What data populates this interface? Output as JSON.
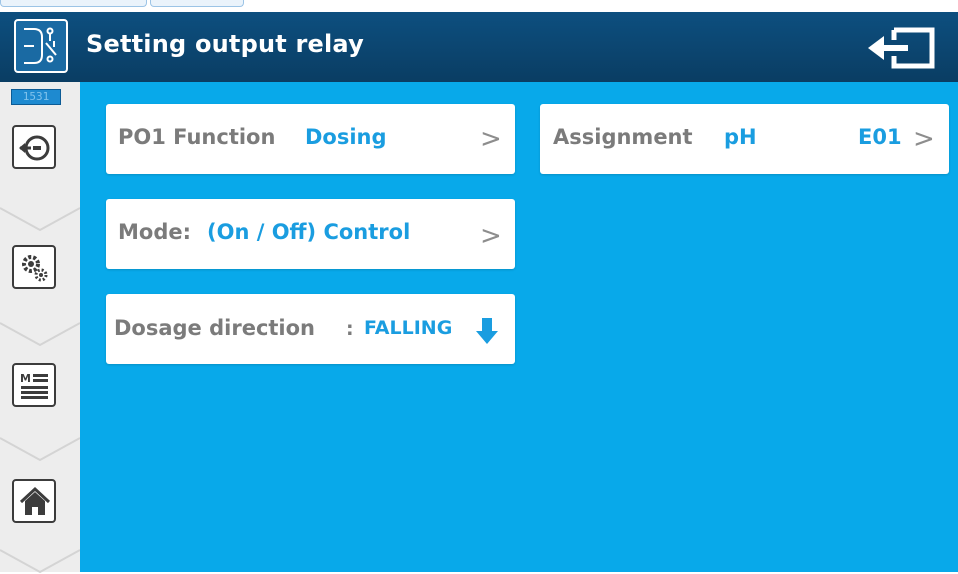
{
  "header": {
    "title": "Setting output relay",
    "icon": "relay-switch-icon",
    "exit_icon": "exit-arrow-icon"
  },
  "sidebar": {
    "counter": "1531",
    "buttons": [
      {
        "icon": "back-arrow-icon"
      },
      {
        "icon": "gears-icon"
      },
      {
        "icon": "menu-list-icon"
      },
      {
        "icon": "home-icon"
      }
    ]
  },
  "cards": {
    "function": {
      "label": "PO1 Function",
      "value": "Dosing",
      "arrow": ">"
    },
    "mode": {
      "label": "Mode:",
      "value": "(On / Off) Control",
      "arrow": ">"
    },
    "dosage": {
      "label": "Dosage direction",
      "separator": ":",
      "value": "FALLING",
      "icon": "down-arrow-icon"
    },
    "assignment": {
      "label": "Assignment",
      "value": "pH",
      "code": "E01",
      "arrow": ">"
    }
  },
  "colors": {
    "header_bg": "#0a3d63",
    "main_bg": "#08a9ea",
    "accent_text": "#1a9de0",
    "label_text": "#7b7b7b"
  }
}
